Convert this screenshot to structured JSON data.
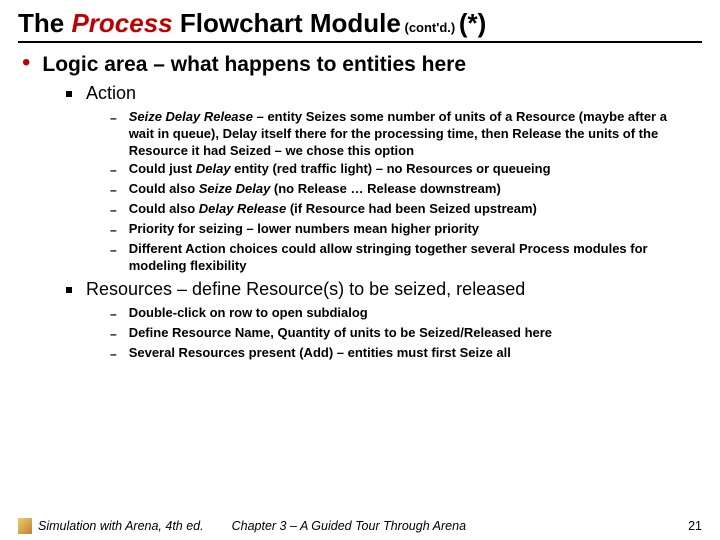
{
  "title": {
    "part1": "The ",
    "part_red": "Process",
    "part2": " Flowchart Module",
    "contd": " (cont'd.) ",
    "star": "(*)"
  },
  "lvl0": {
    "text": "Logic area – what happens to entities here"
  },
  "action": {
    "header": "Action",
    "items": [
      {
        "lead": "Seize Delay Release",
        "rest": " – entity Seizes some number of units of a Resource (maybe after a wait in queue), Delay itself there for the processing time, then Release the units of the Resource it had Seized – we chose this option"
      },
      {
        "pre": "Could just ",
        "lead": "Delay",
        "rest": " entity (red traffic light) – no Resources or queueing"
      },
      {
        "pre": "Could also ",
        "lead": "Seize Delay",
        "rest": " (no Release … Release downstream)"
      },
      {
        "pre": "Could also ",
        "lead": "Delay Release",
        "rest": " (if Resource had been Seized upstream)"
      },
      {
        "pre": "Priority for seizing – lower numbers mean higher priority"
      },
      {
        "pre": "Different Action choices could allow stringing together several Process modules for modeling flexibility"
      }
    ]
  },
  "resources": {
    "header": "Resources – define Resource(s) to be seized, released",
    "items": [
      "Double-click on row to open subdialog",
      "Define Resource Name, Quantity of units to be Seized/Released here",
      "Several Resources present (Add) – entities must first Seize all"
    ]
  },
  "footer": {
    "book": "Simulation with Arena, 4th ed.",
    "chapter": "Chapter 3 – A Guided Tour Through Arena",
    "page": "21"
  }
}
